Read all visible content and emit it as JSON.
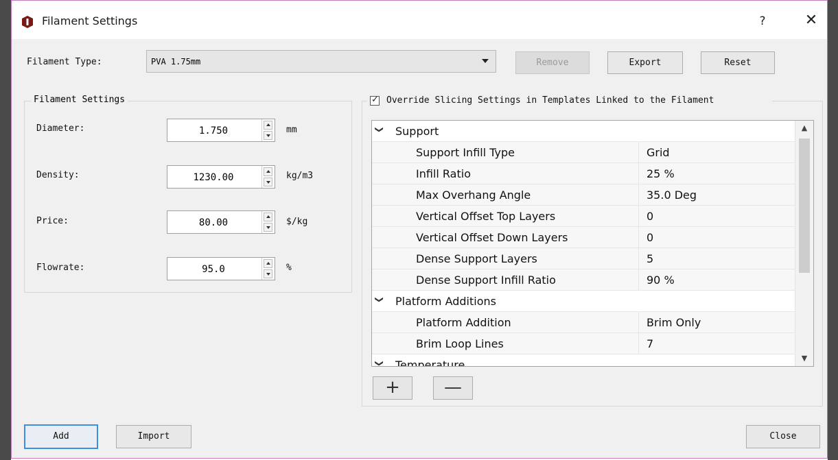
{
  "window": {
    "title": "Filament Settings",
    "help_label": "?",
    "close_glyph": "✕",
    "icon": "app-icon"
  },
  "filament_type": {
    "label": "Filament Type:",
    "value": "PVA 1.75mm",
    "remove_label": "Remove",
    "export_label": "Export",
    "reset_label": "Reset"
  },
  "filament_settings": {
    "group_title": "Filament Settings",
    "fields": [
      {
        "label": "Diameter:",
        "value": "1.750",
        "unit": "mm"
      },
      {
        "label": "Density:",
        "value": "1230.00",
        "unit": "kg/m3"
      },
      {
        "label": "Price:",
        "value": "80.00",
        "unit": "$/kg"
      },
      {
        "label": "Flowrate:",
        "value": "95.0",
        "unit": "%"
      }
    ]
  },
  "override": {
    "checked": true,
    "label": "Override Slicing Settings in Templates Linked to the Filament"
  },
  "tree": {
    "categories": [
      {
        "name": "Support"
      },
      {
        "name": "Platform Additions"
      }
    ],
    "support_rows": [
      {
        "key": "Support Infill Type",
        "value": "Grid"
      },
      {
        "key": "Infill Ratio",
        "value": "25 %"
      },
      {
        "key": "Max Overhang Angle",
        "value": "35.0 Deg"
      },
      {
        "key": "Vertical Offset Top Layers",
        "value": "0"
      },
      {
        "key": "Vertical Offset Down Layers",
        "value": "0"
      },
      {
        "key": "Dense Support Layers",
        "value": "5"
      },
      {
        "key": "Dense Support Infill Ratio",
        "value": "90 %"
      }
    ],
    "platform_rows": [
      {
        "key": "Platform Addition",
        "value": "Brim Only"
      },
      {
        "key": "Brim Loop Lines",
        "value": "7"
      }
    ],
    "next_category_partial": "Temperature"
  },
  "tree_buttons": {
    "add_glyph": "+",
    "remove_glyph": "—"
  },
  "footer": {
    "add_label": "Add",
    "import_label": "Import",
    "close_label": "Close"
  }
}
